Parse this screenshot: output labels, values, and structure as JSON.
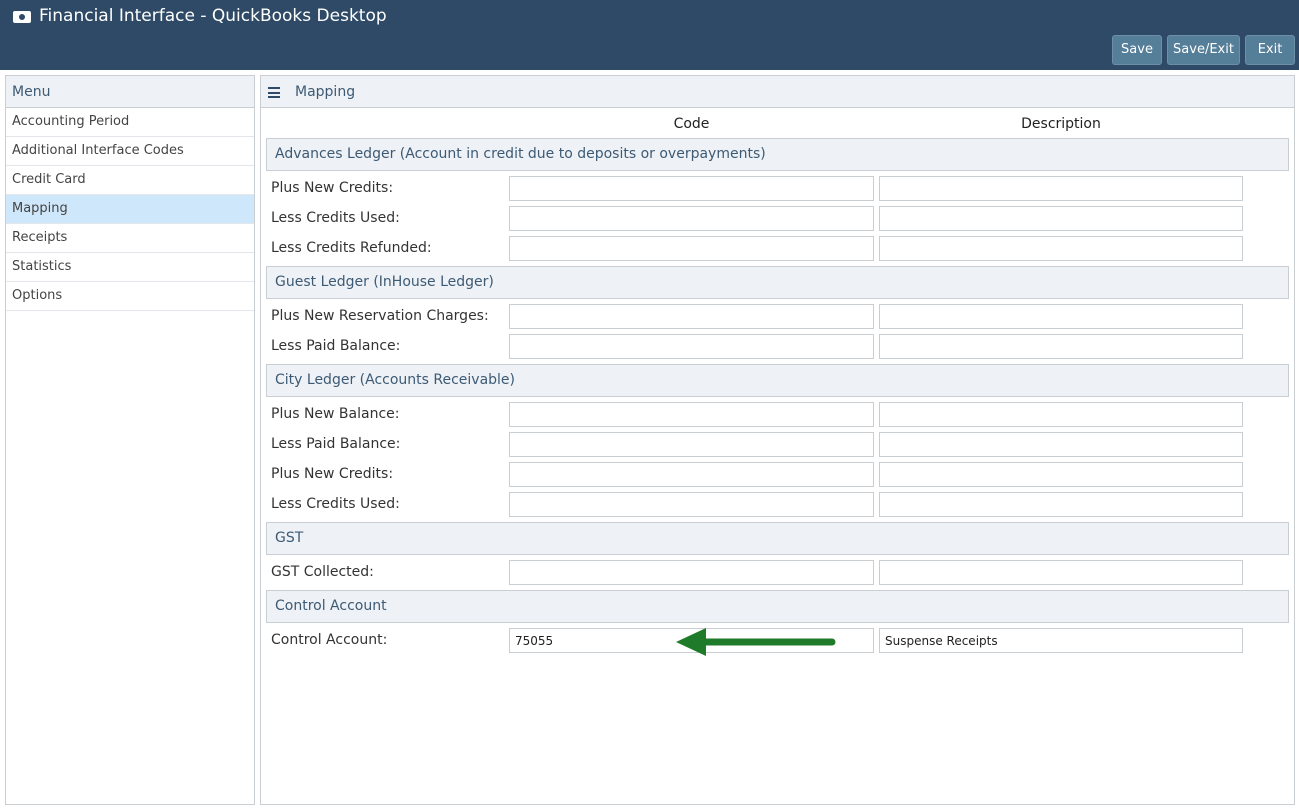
{
  "window": {
    "title": "Financial Interface - QuickBooks Desktop",
    "icon": "money-icon"
  },
  "toolbar": {
    "save_label": "Save",
    "save_exit_label": "Save/Exit",
    "exit_label": "Exit"
  },
  "sidebar": {
    "header": "Menu",
    "items": [
      {
        "label": "Accounting Period"
      },
      {
        "label": "Additional Interface Codes"
      },
      {
        "label": "Credit Card"
      },
      {
        "label": "Mapping",
        "active": true
      },
      {
        "label": "Receipts"
      },
      {
        "label": "Statistics"
      },
      {
        "label": "Options"
      }
    ]
  },
  "main": {
    "title": "Mapping",
    "columns": {
      "code": "Code",
      "description": "Description"
    },
    "sections": [
      {
        "title": "Advances Ledger (Account in credit due to deposits or overpayments)",
        "rows": [
          {
            "label": "Plus New Credits:",
            "code": "",
            "description": ""
          },
          {
            "label": "Less Credits Used:",
            "code": "",
            "description": ""
          },
          {
            "label": "Less Credits Refunded:",
            "code": "",
            "description": ""
          }
        ]
      },
      {
        "title": "Guest Ledger (InHouse Ledger)",
        "rows": [
          {
            "label": "Plus New Reservation Charges:",
            "code": "",
            "description": ""
          },
          {
            "label": "Less Paid Balance:",
            "code": "",
            "description": ""
          }
        ]
      },
      {
        "title": "City Ledger (Accounts Receivable)",
        "rows": [
          {
            "label": "Plus New Balance:",
            "code": "",
            "description": ""
          },
          {
            "label": "Less Paid Balance:",
            "code": "",
            "description": ""
          },
          {
            "label": "Plus New Credits:",
            "code": "",
            "description": ""
          },
          {
            "label": "Less Credits Used:",
            "code": "",
            "description": ""
          }
        ]
      },
      {
        "title": "GST",
        "rows": [
          {
            "label": "GST Collected:",
            "code": "",
            "description": ""
          }
        ]
      },
      {
        "title": "Control Account",
        "rows": [
          {
            "label": "Control Account:",
            "code": "75055",
            "description": "Suspense Receipts"
          }
        ]
      }
    ]
  },
  "annotation": {
    "arrow_color": "#1f7a2a"
  },
  "colors": {
    "header_bg": "#2e4a66",
    "button_bg": "#557e99",
    "active_item_bg": "#cfe7fb",
    "section_bg": "#eef1f5"
  }
}
